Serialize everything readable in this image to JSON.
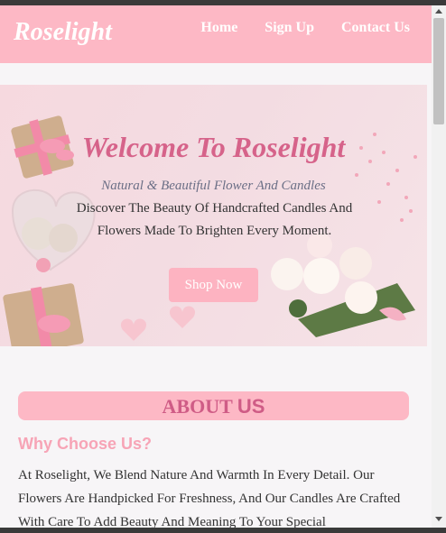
{
  "header": {
    "logo": "Roselight",
    "nav": [
      {
        "label": "Home"
      },
      {
        "label": "Sign Up"
      },
      {
        "label": "Contact Us"
      }
    ]
  },
  "hero": {
    "title": "Welcome To Roselight",
    "subtitle": "Natural & Beautiful Flower And Candles",
    "description": "Discover The Beauty Of Handcrafted Candles And Flowers Made To Brighten Every Moment.",
    "button_label": "Shop Now"
  },
  "about": {
    "heading_part1": "ABOUT ",
    "heading_part2": "US",
    "subheading": "Why Choose Us?",
    "text": "At Roselight, We Blend Nature And Warmth In Every Detail. Our Flowers Are Handpicked For Freshness, And Our Candles Are Crafted With Care To Add Beauty And Meaning To Your Special"
  },
  "colors": {
    "brand_pink": "#fdb8c5",
    "title_pink": "#d6638a",
    "subheading_pink": "#f7a4b6"
  }
}
